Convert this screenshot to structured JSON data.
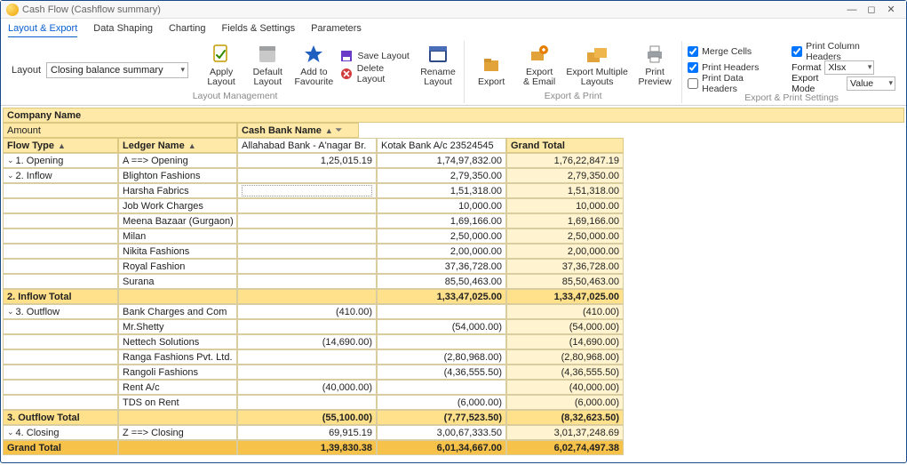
{
  "title": "Cash Flow (Cashflow summary)",
  "menu": {
    "items": [
      "Layout & Export",
      "Data Shaping",
      "Charting",
      "Fields & Settings",
      "Parameters"
    ]
  },
  "ribbon": {
    "layout_label": "Layout",
    "layout_value": "Closing balance summary",
    "btn": {
      "apply": "Apply\nLayout",
      "default": "Default\nLayout",
      "addfav": "Add to\nFavourite",
      "save": "Save Layout",
      "delete": "Delete Layout",
      "rename": "Rename\nLayout",
      "export": "Export",
      "exportemail": "Export\n& Email",
      "exportmulti": "Export Multiple\nLayouts",
      "preview": "Print\nPreview"
    },
    "grp": {
      "layout": "Layout Management",
      "export": "Export & Print",
      "settings": "Export & Print Settings"
    },
    "chk": {
      "merge": "Merge Cells",
      "printhead": "Print Headers",
      "printdata": "Print Data Headers",
      "printcol": "Print Column Headers"
    },
    "fmt": {
      "format_label": "Format",
      "format_value": "Xlsx",
      "mode_label": "Export Mode",
      "mode_value": "Value"
    }
  },
  "grid": {
    "company_label": "Company Name",
    "amount_label": "Amount",
    "cashbank_label": "Cash Bank Name",
    "cols": {
      "flow": "Flow Type",
      "ledger": "Ledger Name",
      "bank1": "Allahabad Bank - A'nagar Br.",
      "bank2": "Kotak Bank A/c 23524545",
      "gt": "Grand Total"
    },
    "rows": [
      {
        "sect": "1. Opening",
        "ledger": "A ==> Opening",
        "b1": "1,25,015.19",
        "b2": "1,74,97,832.00",
        "gt": "1,76,22,847.19",
        "sectExpand": true
      },
      {
        "sect": "2. Inflow",
        "ledger": "Blighton Fashions",
        "b1": "",
        "b2": "2,79,350.00",
        "gt": "2,79,350.00",
        "sectExpand": true
      },
      {
        "ledger": "Harsha Fabrics",
        "b1": "",
        "b2": "1,51,318.00",
        "gt": "1,51,318.00",
        "editing1": true
      },
      {
        "ledger": "Job Work Charges",
        "b1": "",
        "b2": "10,000.00",
        "gt": "10,000.00"
      },
      {
        "ledger": "Meena Bazaar (Gurgaon)",
        "b1": "",
        "b2": "1,69,166.00",
        "gt": "1,69,166.00"
      },
      {
        "ledger": "Milan",
        "b1": "",
        "b2": "2,50,000.00",
        "gt": "2,50,000.00"
      },
      {
        "ledger": "Nikita Fashions",
        "b1": "",
        "b2": "2,00,000.00",
        "gt": "2,00,000.00"
      },
      {
        "ledger": "Royal Fashion",
        "b1": "",
        "b2": "37,36,728.00",
        "gt": "37,36,728.00"
      },
      {
        "ledger": "Surana",
        "b1": "",
        "b2": "85,50,463.00",
        "gt": "85,50,463.00"
      }
    ],
    "inflow_total": {
      "label": "2. Inflow Total",
      "b1": "",
      "b2": "1,33,47,025.00",
      "gt": "1,33,47,025.00"
    },
    "out": [
      {
        "sect": "3. Outflow",
        "ledger": "Bank Charges and Com",
        "b1": "(410.00)",
        "b2": "",
        "gt": "(410.00)",
        "sectExpand": true
      },
      {
        "ledger": "Mr.Shetty",
        "b1": "",
        "b2": "(54,000.00)",
        "gt": "(54,000.00)"
      },
      {
        "ledger": "Nettech Solutions",
        "b1": "(14,690.00)",
        "b2": "",
        "gt": "(14,690.00)"
      },
      {
        "ledger": "Ranga Fashions Pvt. Ltd.",
        "b1": "",
        "b2": "(2,80,968.00)",
        "gt": "(2,80,968.00)"
      },
      {
        "ledger": "Rangoli Fashions",
        "b1": "",
        "b2": "(4,36,555.50)",
        "gt": "(4,36,555.50)"
      },
      {
        "ledger": "Rent A/c",
        "b1": "(40,000.00)",
        "b2": "",
        "gt": "(40,000.00)"
      },
      {
        "ledger": "TDS on Rent",
        "b1": "",
        "b2": "(6,000.00)",
        "gt": "(6,000.00)"
      }
    ],
    "outflow_total": {
      "label": "3. Outflow Total",
      "b1": "(55,100.00)",
      "b2": "(7,77,523.50)",
      "gt": "(8,32,623.50)"
    },
    "closing": {
      "sect": "4. Closing",
      "ledger": "Z ==> Closing",
      "b1": "69,915.19",
      "b2": "3,00,67,333.50",
      "gt": "3,01,37,248.69"
    },
    "grand": {
      "label": "Grand Total",
      "b1": "1,39,830.38",
      "b2": "6,01,34,667.00",
      "gt": "6,02,74,497.38"
    }
  }
}
